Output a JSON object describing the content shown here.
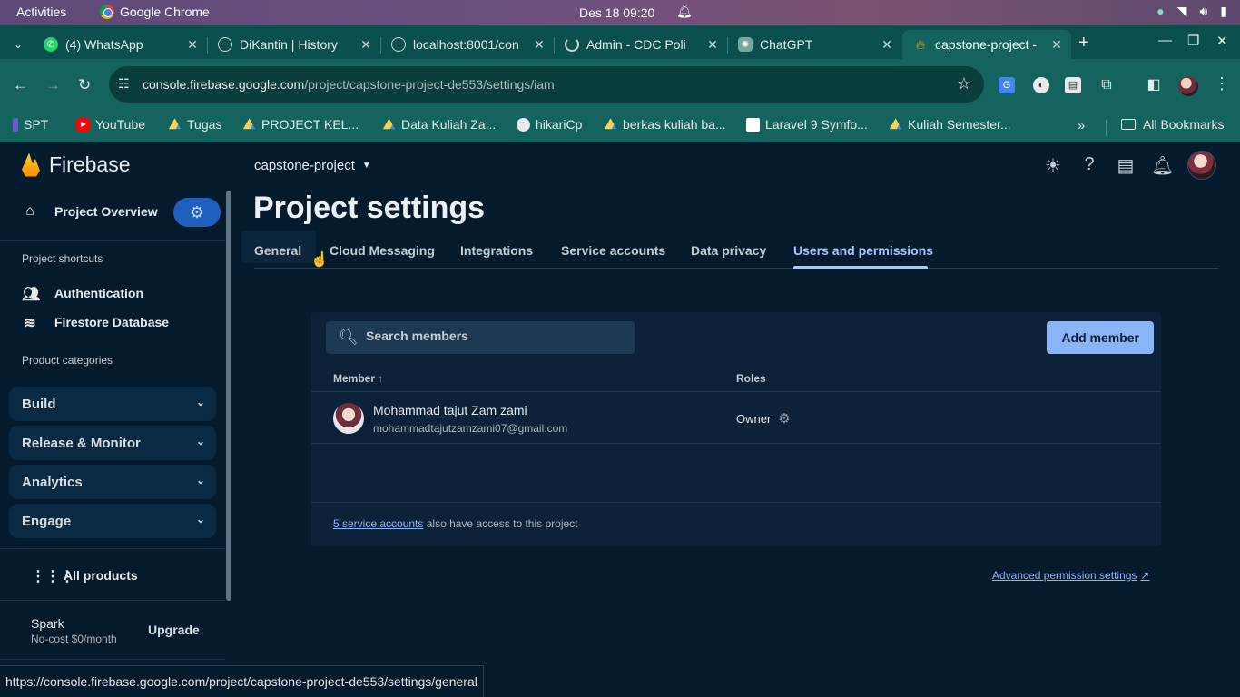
{
  "os_bar": {
    "activities": "Activities",
    "app_name": "Google Chrome",
    "datetime": "Des 18  09:20"
  },
  "browser": {
    "tabs": [
      {
        "title": "(4) WhatsApp",
        "icon": "whatsapp-icon",
        "color": "#25d366"
      },
      {
        "title": "DiKantin | History",
        "icon": "globe-icon",
        "color": "#5f8a7a"
      },
      {
        "title": "localhost:8001/con",
        "icon": "globe-icon",
        "color": "#5f8a7a"
      },
      {
        "title": "Admin - CDC Poli",
        "icon": "loading-icon",
        "color": "#5f8a7a"
      },
      {
        "title": "ChatGPT",
        "icon": "chatgpt-icon",
        "color": "#74aa9c"
      },
      {
        "title": "capstone-project -",
        "icon": "firebase-icon",
        "color": "#ffa000",
        "active": true
      }
    ],
    "url_host": "console.firebase.google.com",
    "url_path": "/project/capstone-project-de553/settings/iam",
    "bookmarks": [
      {
        "label": "SPT",
        "icon": "spt-icon"
      },
      {
        "label": "YouTube",
        "icon": "youtube-icon"
      },
      {
        "label": "Tugas",
        "icon": "drive-icon"
      },
      {
        "label": "PROJECT KEL...",
        "icon": "drive-icon"
      },
      {
        "label": "Data Kuliah Za...",
        "icon": "drive-icon"
      },
      {
        "label": "hikariCp",
        "icon": "github-icon"
      },
      {
        "label": "berkas kuliah ba...",
        "icon": "drive-icon"
      },
      {
        "label": "Laravel 9 Symfo...",
        "icon": "laravel-icon"
      },
      {
        "label": "Kuliah Semester...",
        "icon": "drive-icon"
      }
    ],
    "all_bookmarks": "All Bookmarks",
    "status_url": "https://console.firebase.google.com/project/capstone-project-de553/settings/general"
  },
  "sidebar": {
    "brand": "Firebase",
    "project_overview": "Project Overview",
    "shortcuts_heading": "Project shortcuts",
    "shortcuts": [
      {
        "label": "Authentication",
        "icon": "people-icon"
      },
      {
        "label": "Firestore Database",
        "icon": "firestore-icon"
      }
    ],
    "categories_heading": "Product categories",
    "categories": [
      "Build",
      "Release & Monitor",
      "Analytics",
      "Engage"
    ],
    "all_products": "All products",
    "plan_name": "Spark",
    "plan_desc": "No-cost $0/month",
    "upgrade": "Upgrade"
  },
  "main": {
    "project_name": "capstone-project",
    "page_title": "Project settings",
    "tabs": [
      "General",
      "Cloud Messaging",
      "Integrations",
      "Service accounts",
      "Data privacy",
      "Users and permissions"
    ],
    "active_tab": "Users and permissions",
    "search_placeholder": "Search members",
    "add_member": "Add member",
    "col_member": "Member",
    "col_roles": "Roles",
    "members": [
      {
        "name": "Mohammad tajut Zam zami",
        "email": "mohammadtajutzamzami07@gmail.com",
        "role": "Owner"
      }
    ],
    "footnote_link": "5 service accounts",
    "footnote_text": "also have access to this project",
    "advanced_link": "Advanced permission settings"
  }
}
